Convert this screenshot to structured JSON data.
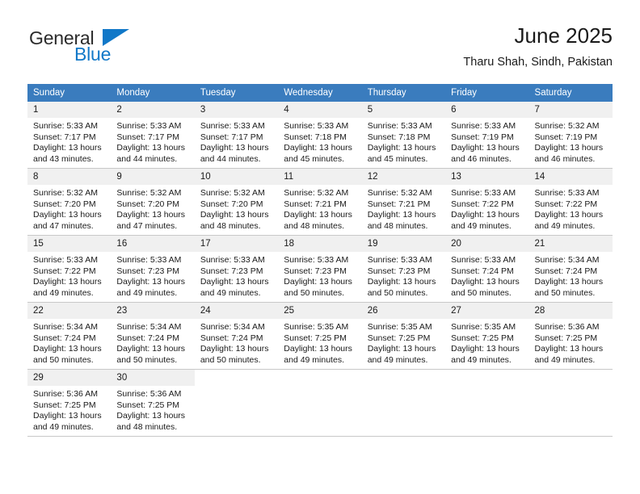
{
  "logo": {
    "word1": "General",
    "word2": "Blue",
    "shape": "triangle",
    "color_primary": "#1178c8",
    "color_text": "#2b2b2b"
  },
  "header": {
    "title": "June 2025",
    "subtitle": "Tharu Shah, Sindh, Pakistan"
  },
  "calendar": {
    "header_bg": "#3a7cbe",
    "header_text_color": "#ffffff",
    "daynum_bg": "#f0f0f0",
    "weekdays": [
      "Sunday",
      "Monday",
      "Tuesday",
      "Wednesday",
      "Thursday",
      "Friday",
      "Saturday"
    ],
    "weeks": [
      [
        {
          "day": "1",
          "l1": "Sunrise: 5:33 AM",
          "l2": "Sunset: 7:17 PM",
          "l3": "Daylight: 13 hours",
          "l4": "and 43 minutes."
        },
        {
          "day": "2",
          "l1": "Sunrise: 5:33 AM",
          "l2": "Sunset: 7:17 PM",
          "l3": "Daylight: 13 hours",
          "l4": "and 44 minutes."
        },
        {
          "day": "3",
          "l1": "Sunrise: 5:33 AM",
          "l2": "Sunset: 7:17 PM",
          "l3": "Daylight: 13 hours",
          "l4": "and 44 minutes."
        },
        {
          "day": "4",
          "l1": "Sunrise: 5:33 AM",
          "l2": "Sunset: 7:18 PM",
          "l3": "Daylight: 13 hours",
          "l4": "and 45 minutes."
        },
        {
          "day": "5",
          "l1": "Sunrise: 5:33 AM",
          "l2": "Sunset: 7:18 PM",
          "l3": "Daylight: 13 hours",
          "l4": "and 45 minutes."
        },
        {
          "day": "6",
          "l1": "Sunrise: 5:33 AM",
          "l2": "Sunset: 7:19 PM",
          "l3": "Daylight: 13 hours",
          "l4": "and 46 minutes."
        },
        {
          "day": "7",
          "l1": "Sunrise: 5:32 AM",
          "l2": "Sunset: 7:19 PM",
          "l3": "Daylight: 13 hours",
          "l4": "and 46 minutes."
        }
      ],
      [
        {
          "day": "8",
          "l1": "Sunrise: 5:32 AM",
          "l2": "Sunset: 7:20 PM",
          "l3": "Daylight: 13 hours",
          "l4": "and 47 minutes."
        },
        {
          "day": "9",
          "l1": "Sunrise: 5:32 AM",
          "l2": "Sunset: 7:20 PM",
          "l3": "Daylight: 13 hours",
          "l4": "and 47 minutes."
        },
        {
          "day": "10",
          "l1": "Sunrise: 5:32 AM",
          "l2": "Sunset: 7:20 PM",
          "l3": "Daylight: 13 hours",
          "l4": "and 48 minutes."
        },
        {
          "day": "11",
          "l1": "Sunrise: 5:32 AM",
          "l2": "Sunset: 7:21 PM",
          "l3": "Daylight: 13 hours",
          "l4": "and 48 minutes."
        },
        {
          "day": "12",
          "l1": "Sunrise: 5:32 AM",
          "l2": "Sunset: 7:21 PM",
          "l3": "Daylight: 13 hours",
          "l4": "and 48 minutes."
        },
        {
          "day": "13",
          "l1": "Sunrise: 5:33 AM",
          "l2": "Sunset: 7:22 PM",
          "l3": "Daylight: 13 hours",
          "l4": "and 49 minutes."
        },
        {
          "day": "14",
          "l1": "Sunrise: 5:33 AM",
          "l2": "Sunset: 7:22 PM",
          "l3": "Daylight: 13 hours",
          "l4": "and 49 minutes."
        }
      ],
      [
        {
          "day": "15",
          "l1": "Sunrise: 5:33 AM",
          "l2": "Sunset: 7:22 PM",
          "l3": "Daylight: 13 hours",
          "l4": "and 49 minutes."
        },
        {
          "day": "16",
          "l1": "Sunrise: 5:33 AM",
          "l2": "Sunset: 7:23 PM",
          "l3": "Daylight: 13 hours",
          "l4": "and 49 minutes."
        },
        {
          "day": "17",
          "l1": "Sunrise: 5:33 AM",
          "l2": "Sunset: 7:23 PM",
          "l3": "Daylight: 13 hours",
          "l4": "and 49 minutes."
        },
        {
          "day": "18",
          "l1": "Sunrise: 5:33 AM",
          "l2": "Sunset: 7:23 PM",
          "l3": "Daylight: 13 hours",
          "l4": "and 50 minutes."
        },
        {
          "day": "19",
          "l1": "Sunrise: 5:33 AM",
          "l2": "Sunset: 7:23 PM",
          "l3": "Daylight: 13 hours",
          "l4": "and 50 minutes."
        },
        {
          "day": "20",
          "l1": "Sunrise: 5:33 AM",
          "l2": "Sunset: 7:24 PM",
          "l3": "Daylight: 13 hours",
          "l4": "and 50 minutes."
        },
        {
          "day": "21",
          "l1": "Sunrise: 5:34 AM",
          "l2": "Sunset: 7:24 PM",
          "l3": "Daylight: 13 hours",
          "l4": "and 50 minutes."
        }
      ],
      [
        {
          "day": "22",
          "l1": "Sunrise: 5:34 AM",
          "l2": "Sunset: 7:24 PM",
          "l3": "Daylight: 13 hours",
          "l4": "and 50 minutes."
        },
        {
          "day": "23",
          "l1": "Sunrise: 5:34 AM",
          "l2": "Sunset: 7:24 PM",
          "l3": "Daylight: 13 hours",
          "l4": "and 50 minutes."
        },
        {
          "day": "24",
          "l1": "Sunrise: 5:34 AM",
          "l2": "Sunset: 7:24 PM",
          "l3": "Daylight: 13 hours",
          "l4": "and 50 minutes."
        },
        {
          "day": "25",
          "l1": "Sunrise: 5:35 AM",
          "l2": "Sunset: 7:25 PM",
          "l3": "Daylight: 13 hours",
          "l4": "and 49 minutes."
        },
        {
          "day": "26",
          "l1": "Sunrise: 5:35 AM",
          "l2": "Sunset: 7:25 PM",
          "l3": "Daylight: 13 hours",
          "l4": "and 49 minutes."
        },
        {
          "day": "27",
          "l1": "Sunrise: 5:35 AM",
          "l2": "Sunset: 7:25 PM",
          "l3": "Daylight: 13 hours",
          "l4": "and 49 minutes."
        },
        {
          "day": "28",
          "l1": "Sunrise: 5:36 AM",
          "l2": "Sunset: 7:25 PM",
          "l3": "Daylight: 13 hours",
          "l4": "and 49 minutes."
        }
      ],
      [
        {
          "day": "29",
          "l1": "Sunrise: 5:36 AM",
          "l2": "Sunset: 7:25 PM",
          "l3": "Daylight: 13 hours",
          "l4": "and 49 minutes."
        },
        {
          "day": "30",
          "l1": "Sunrise: 5:36 AM",
          "l2": "Sunset: 7:25 PM",
          "l3": "Daylight: 13 hours",
          "l4": "and 48 minutes."
        },
        {
          "day": "",
          "l1": "",
          "l2": "",
          "l3": "",
          "l4": ""
        },
        {
          "day": "",
          "l1": "",
          "l2": "",
          "l3": "",
          "l4": ""
        },
        {
          "day": "",
          "l1": "",
          "l2": "",
          "l3": "",
          "l4": ""
        },
        {
          "day": "",
          "l1": "",
          "l2": "",
          "l3": "",
          "l4": ""
        },
        {
          "day": "",
          "l1": "",
          "l2": "",
          "l3": "",
          "l4": ""
        }
      ]
    ]
  }
}
